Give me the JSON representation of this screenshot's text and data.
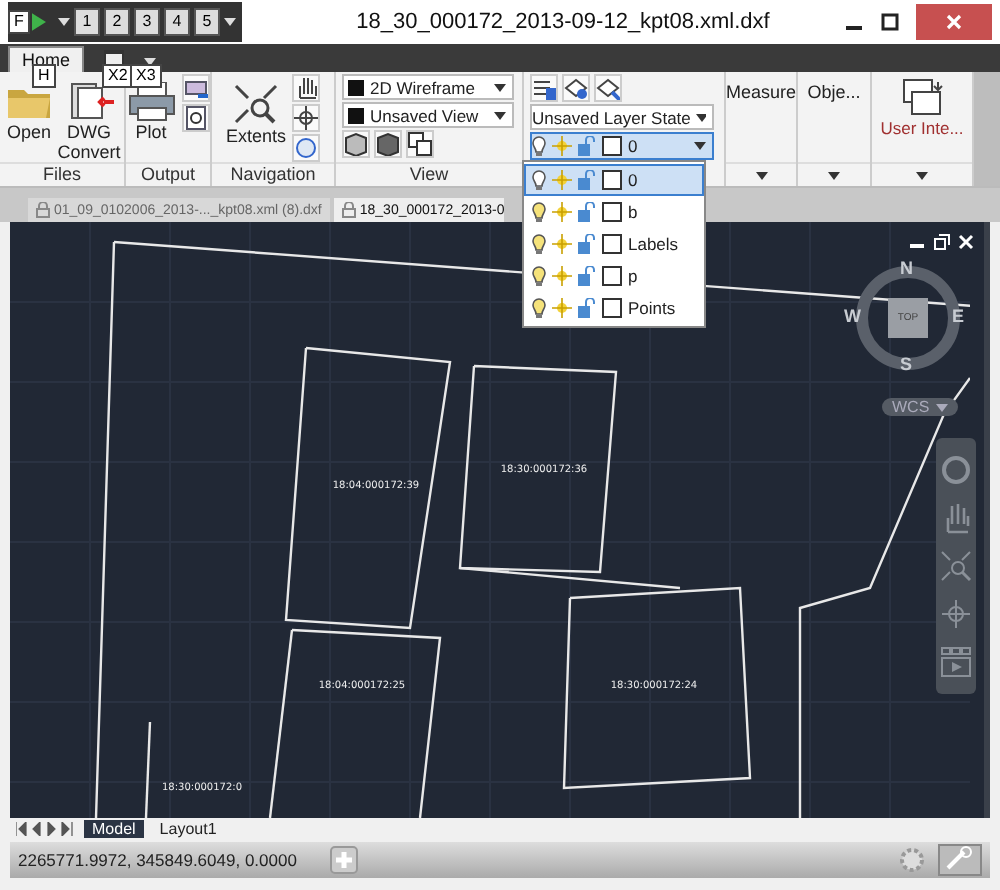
{
  "title_bar": {
    "app_key_tip": "F",
    "quick_access": [
      "1",
      "2",
      "3",
      "4",
      "5"
    ],
    "title": "18_30_000172_2013-09-12_kpt08.xml.dxf"
  },
  "ribbon": {
    "tabs": [
      {
        "label": "Home",
        "selected": true
      }
    ],
    "key_tips": [
      "H",
      "X2",
      "X3"
    ],
    "files": {
      "title": "Files",
      "buttons": [
        "Open",
        "DWG Convert"
      ]
    },
    "output": {
      "title": "Output",
      "button": "Plot"
    },
    "navigation": {
      "title": "Navigation",
      "button": "Extents"
    },
    "view": {
      "title": "View",
      "visual_style": "2D Wireframe",
      "named_view": "Unsaved View"
    },
    "layers": {
      "layer_state": "Unsaved Layer State",
      "current_layer": "0",
      "list": [
        {
          "name": "0",
          "selected": true
        },
        {
          "name": "b",
          "selected": false
        },
        {
          "name": "Labels",
          "selected": false
        },
        {
          "name": "p",
          "selected": false
        },
        {
          "name": "Points",
          "selected": false
        }
      ]
    },
    "measure": "Measure",
    "objects": "Obje...",
    "user_interface": "User Inte..."
  },
  "document_tabs": [
    {
      "label": "01_09_0102006_2013-..._kpt08.xml (8).dxf",
      "selected": false
    },
    {
      "label": "18_30_000172_2013-0",
      "selected": true
    }
  ],
  "drawing": {
    "parcel_labels": [
      "18:04:000172:39",
      "18:30:000172:36",
      "18:04:000172:25",
      "18:30:000172:24",
      "18:30:000172:0"
    ],
    "view_cube": {
      "north": "N",
      "south": "S",
      "east": "E",
      "west": "W",
      "face": "TOP",
      "ucs": "WCS"
    }
  },
  "layout_tabs": [
    {
      "label": "Model",
      "selected": true
    },
    {
      "label": "Layout1",
      "selected": false
    }
  ],
  "status_bar": {
    "coordinates": "2265771.9972, 345849.6049, 0.0000"
  }
}
